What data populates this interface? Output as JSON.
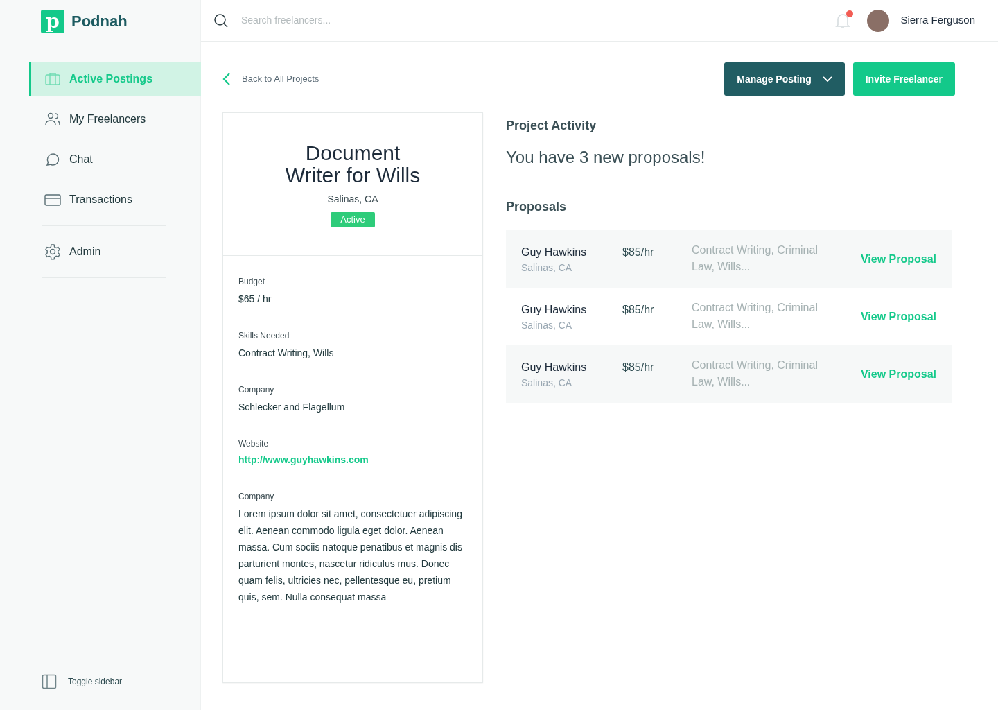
{
  "brand": {
    "name": "Podnah",
    "logo_letter": "p"
  },
  "sidebar": {
    "groups": [
      [
        {
          "label": "Active Postings",
          "kind": "briefcase",
          "selected": true
        },
        {
          "label": "My Freelancers",
          "kind": "people",
          "selected": false
        },
        {
          "label": "Chat",
          "kind": "chat",
          "selected": false
        },
        {
          "label": "Transactions",
          "kind": "card",
          "selected": false
        }
      ],
      [
        {
          "label": "Admin",
          "kind": "gear",
          "selected": false
        }
      ]
    ],
    "toggle": "Toggle sidebar"
  },
  "topbar": {
    "search": {
      "placeholder": "Search freelancers..."
    },
    "notifications_unread": true,
    "user": "Sierra Ferguson"
  },
  "back_link": "Back to All Projects",
  "actions": {
    "manage": "Manage Posting",
    "invite": "Invite Freelancer"
  },
  "project": {
    "title": "Document Writer for Wills",
    "location": "Salinas, CA",
    "status": "Active",
    "fields": [
      {
        "label": "Budget",
        "value": "$65 / hr",
        "kind": "text"
      },
      {
        "label": "Skills Needed",
        "value": "Contract Writing, Wills",
        "kind": "text"
      },
      {
        "label": "Company",
        "value": "Schlecker and Flagellum",
        "kind": "text"
      },
      {
        "label": "Website",
        "value": "http://www.guyhawkins.com",
        "kind": "link"
      },
      {
        "label": "Company",
        "value": "Lorem ipsum dolor sit amet, consectetuer adipiscing elit. Aenean commodo ligula eget dolor. Aenean massa. Cum sociis natoque penatibus et magnis dis parturient montes, nascetur ridiculus mus. Donec quam felis, ultricies nec, pellentesque eu, pretium quis, sem. Nulla consequat massa",
        "kind": "text"
      }
    ]
  },
  "activity": {
    "heading": "Project Activity",
    "message": "You have 3 new proposals!",
    "proposals_heading": "Proposals",
    "proposals": [
      {
        "name": "Guy Hawkins",
        "location": "Salinas, CA",
        "rate": "$85/hr",
        "skills": "Contract Writing, Criminal Law, Wills...",
        "action": "View Proposal"
      },
      {
        "name": "Guy Hawkins",
        "location": "Salinas, CA",
        "rate": "$85/hr",
        "skills": "Contract Writing, Criminal Law, Wills...",
        "action": "View Proposal"
      },
      {
        "name": "Guy Hawkins",
        "location": "Salinas, CA",
        "rate": "$85/hr",
        "skills": "Contract Writing, Criminal Law, Wills...",
        "action": "View Proposal"
      }
    ]
  }
}
